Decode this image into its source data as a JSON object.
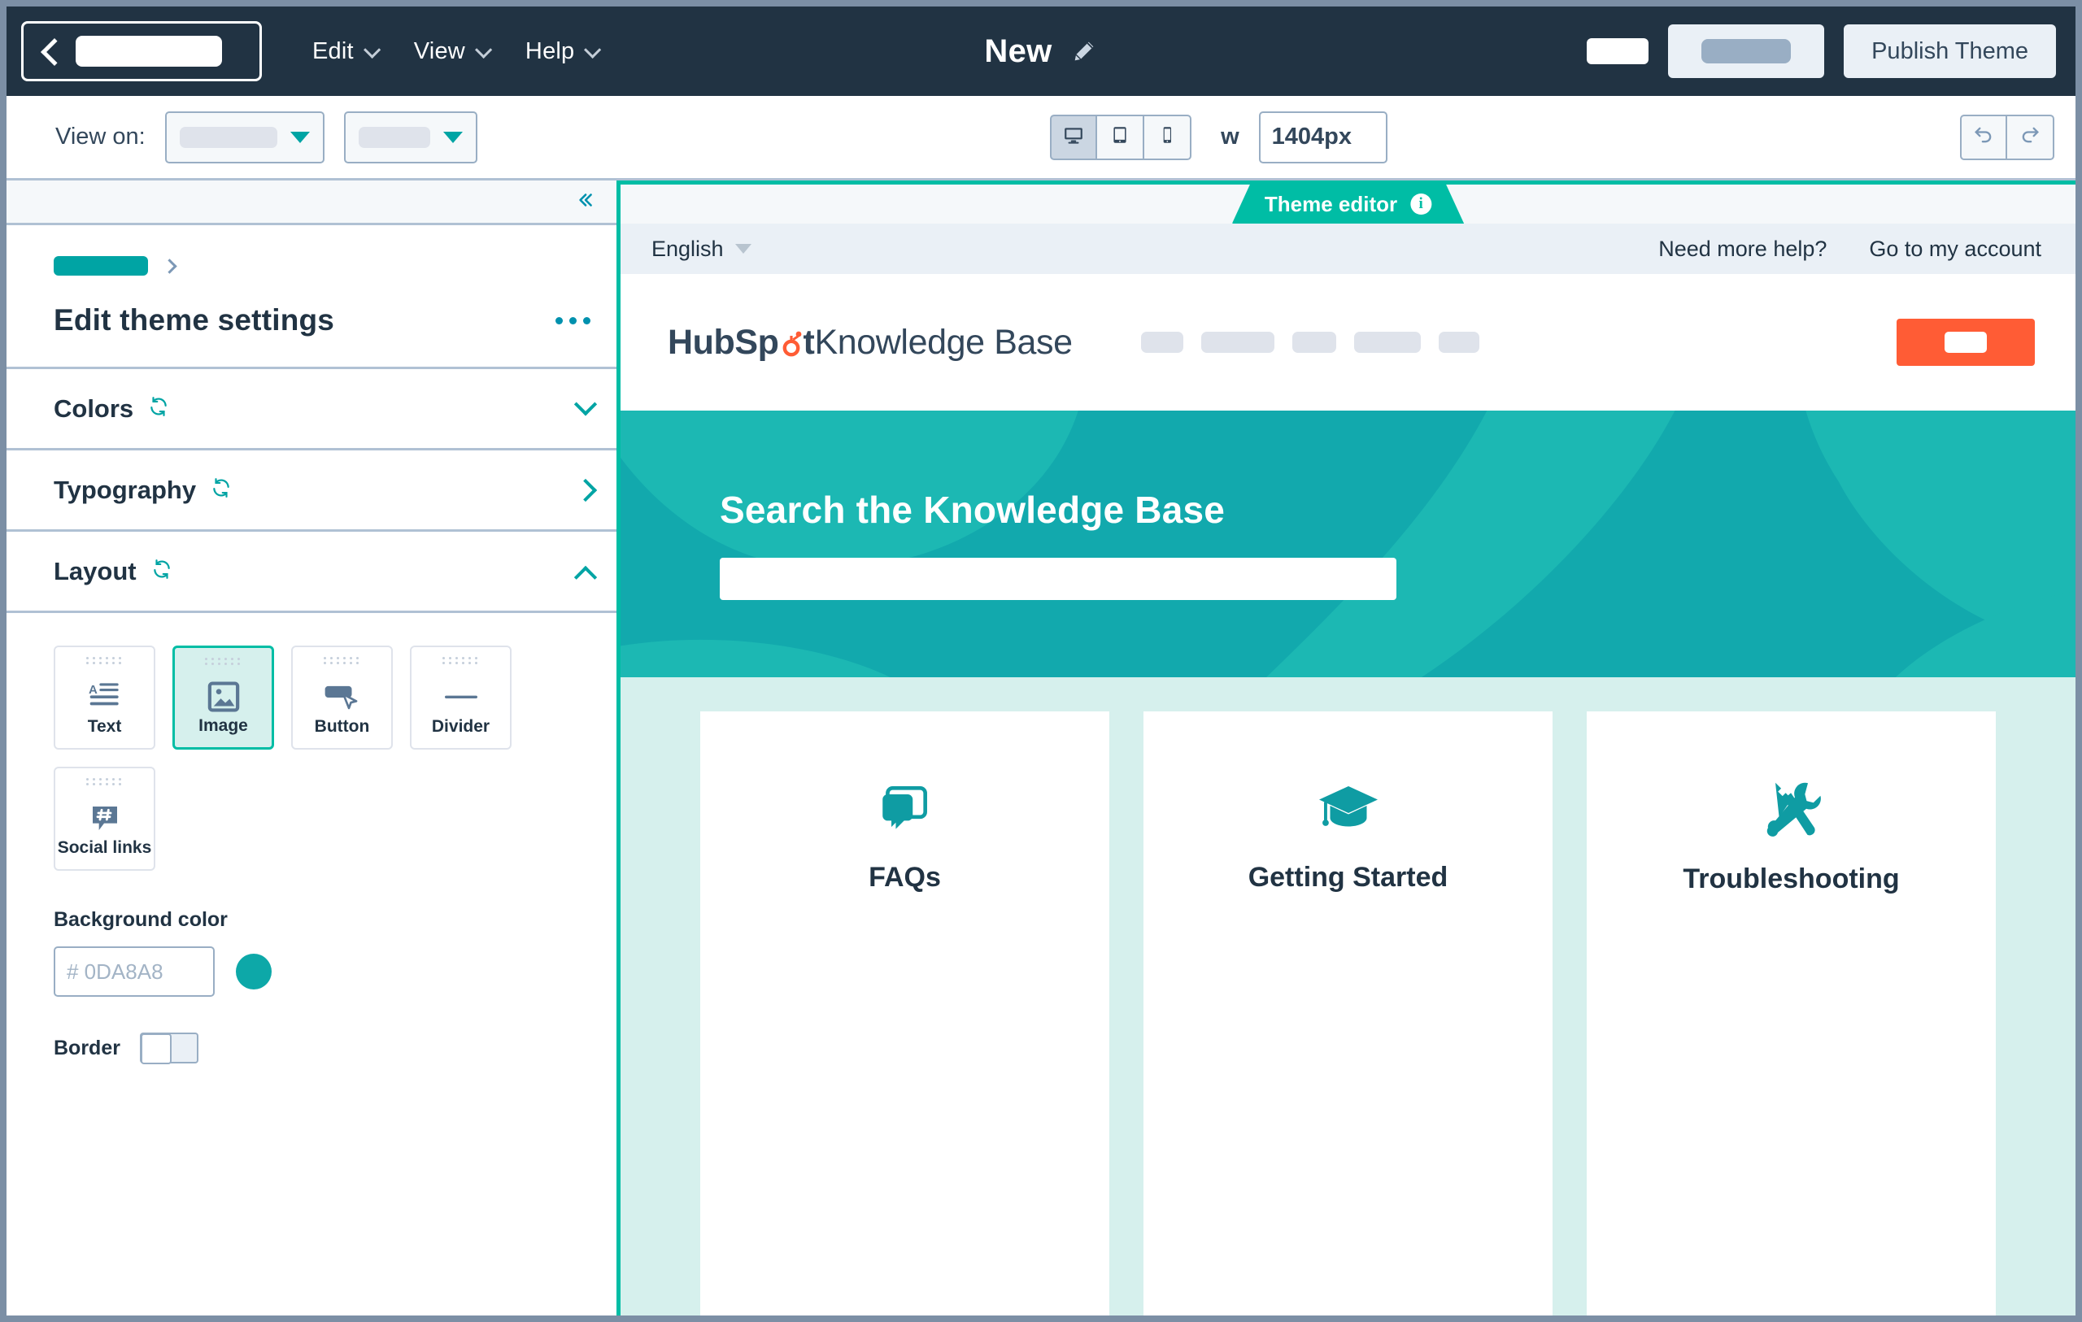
{
  "topbar": {
    "back_button": {
      "name": "back-button",
      "redacted": true
    },
    "menus": [
      {
        "label": "Edit"
      },
      {
        "label": "View"
      },
      {
        "label": "Help"
      }
    ],
    "document_title": "New",
    "edit_title_icon": "pencil-icon",
    "right_redacted_label": "",
    "secondary_button_redacted": "",
    "publish_label": "Publish Theme",
    "background_color": "#213343"
  },
  "toolbar": {
    "view_on_label": "View on:",
    "selects": [
      {
        "name": "page-select",
        "value": ""
      },
      {
        "name": "template-select",
        "value": ""
      }
    ],
    "devices": [
      {
        "name": "desktop",
        "icon": "desktop-icon",
        "active": true
      },
      {
        "name": "tablet",
        "icon": "tablet-icon",
        "active": false
      },
      {
        "name": "mobile",
        "icon": "mobile-icon",
        "active": false
      }
    ],
    "width_label": "w",
    "width_value": "1404px",
    "undo_label": "Undo",
    "redo_label": "Redo"
  },
  "sidebar": {
    "collapse_icon": "double-chevron-left-icon",
    "breadcrumb": {
      "redacted": true,
      "separator": "chevron-right-icon"
    },
    "title": "Edit theme settings",
    "more_menu_icon": "ellipsis-icon",
    "accordions": [
      {
        "label": "Colors",
        "reset_icon": "reset-icon",
        "state": "collapsed",
        "chevron": "chevron-down-icon"
      },
      {
        "label": "Typography",
        "reset_icon": "reset-icon",
        "state": "collapsed",
        "chevron": "chevron-right-icon"
      },
      {
        "label": "Layout",
        "reset_icon": "reset-icon",
        "state": "expanded",
        "chevron": "chevron-up-icon"
      }
    ],
    "modules": [
      {
        "label": "Text",
        "icon": "text-icon",
        "selected": false
      },
      {
        "label": "Image",
        "icon": "image-icon",
        "selected": true
      },
      {
        "label": "Button",
        "icon": "button-icon",
        "selected": false
      },
      {
        "label": "Divider",
        "icon": "divider-icon",
        "selected": false
      },
      {
        "label": "Social links",
        "icon": "social-links-icon",
        "selected": false
      }
    ],
    "background_color_label": "Background color",
    "background_color_placeholder": "# 0DA8A8",
    "background_color_value": "",
    "swatch_color": "#0DA8A8",
    "border_label": "Border",
    "border_enabled": false,
    "accent_color": "#00BDA5"
  },
  "preview": {
    "tab_label": "Theme editor",
    "tab_info_icon": "info-icon",
    "tab_info_glyph": "i",
    "utility": {
      "language": "English",
      "language_chevron": "triangle-down-icon",
      "links": [
        "Need more help?",
        "Go to my account"
      ]
    },
    "header": {
      "logo_primary": "HubSp",
      "logo_sprocket": "o",
      "logo_primary_tail": "t",
      "logo_secondary": " Knowledge Base",
      "nav_items": [
        {
          "redacted": true,
          "width": 52
        },
        {
          "redacted": true,
          "width": 90
        },
        {
          "redacted": true,
          "width": 54
        },
        {
          "redacted": true,
          "width": 82
        },
        {
          "redacted": true,
          "width": 50
        }
      ],
      "cta_redacted": true,
      "cta_color": "#FF5C35"
    },
    "hero": {
      "title": "Search the Knowledge Base",
      "search_placeholder": "",
      "search_value": "",
      "search_icon": "search-icon",
      "background_color": "#12A9AD",
      "blob_color": "#1CB8B3"
    },
    "cards_band_color": "#D6F0ED",
    "cards": [
      {
        "label": "FAQs",
        "icon": "speech-bubbles-icon"
      },
      {
        "label": "Getting Started",
        "icon": "graduation-cap-icon"
      },
      {
        "label": "Troubleshooting",
        "icon": "wrench-screwdriver-icon"
      }
    ]
  }
}
